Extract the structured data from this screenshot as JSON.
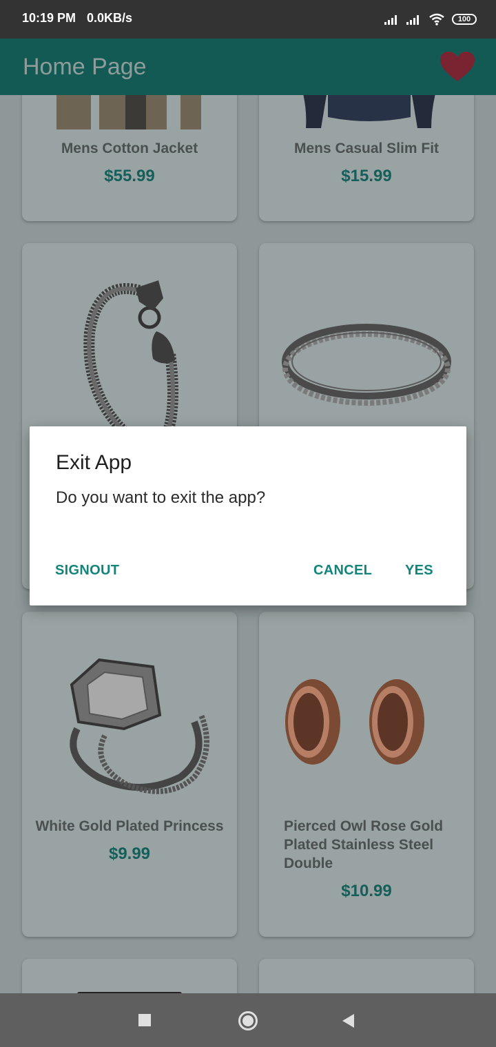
{
  "status_bar": {
    "time": "10:19 PM",
    "speed": "0.0KB/s",
    "battery": "100"
  },
  "app_bar": {
    "title": "Home Page",
    "favorite_icon": "heart-icon",
    "favorite_color": "#c0394b"
  },
  "products": [
    {
      "name": "Mens Cotton Jacket",
      "price": "$55.99"
    },
    {
      "name": "Mens Casual Slim Fit",
      "price": "$15.99"
    },
    {
      "name": "",
      "price": ""
    },
    {
      "name": "",
      "price": ""
    },
    {
      "name": "White Gold Plated Princess",
      "price": "$9.99"
    },
    {
      "name": "Pierced Owl Rose Gold Plated Stainless Steel Double",
      "price": "$10.99"
    }
  ],
  "dialog": {
    "title": "Exit App",
    "message": "Do you want to exit the app?",
    "signout_label": "SIGNOUT",
    "cancel_label": "CANCEL",
    "yes_label": "YES",
    "accent_color": "#12857a"
  },
  "nav_bar": {
    "recents_icon": "square-icon",
    "home_icon": "circle-icon",
    "back_icon": "triangle-back-icon"
  }
}
